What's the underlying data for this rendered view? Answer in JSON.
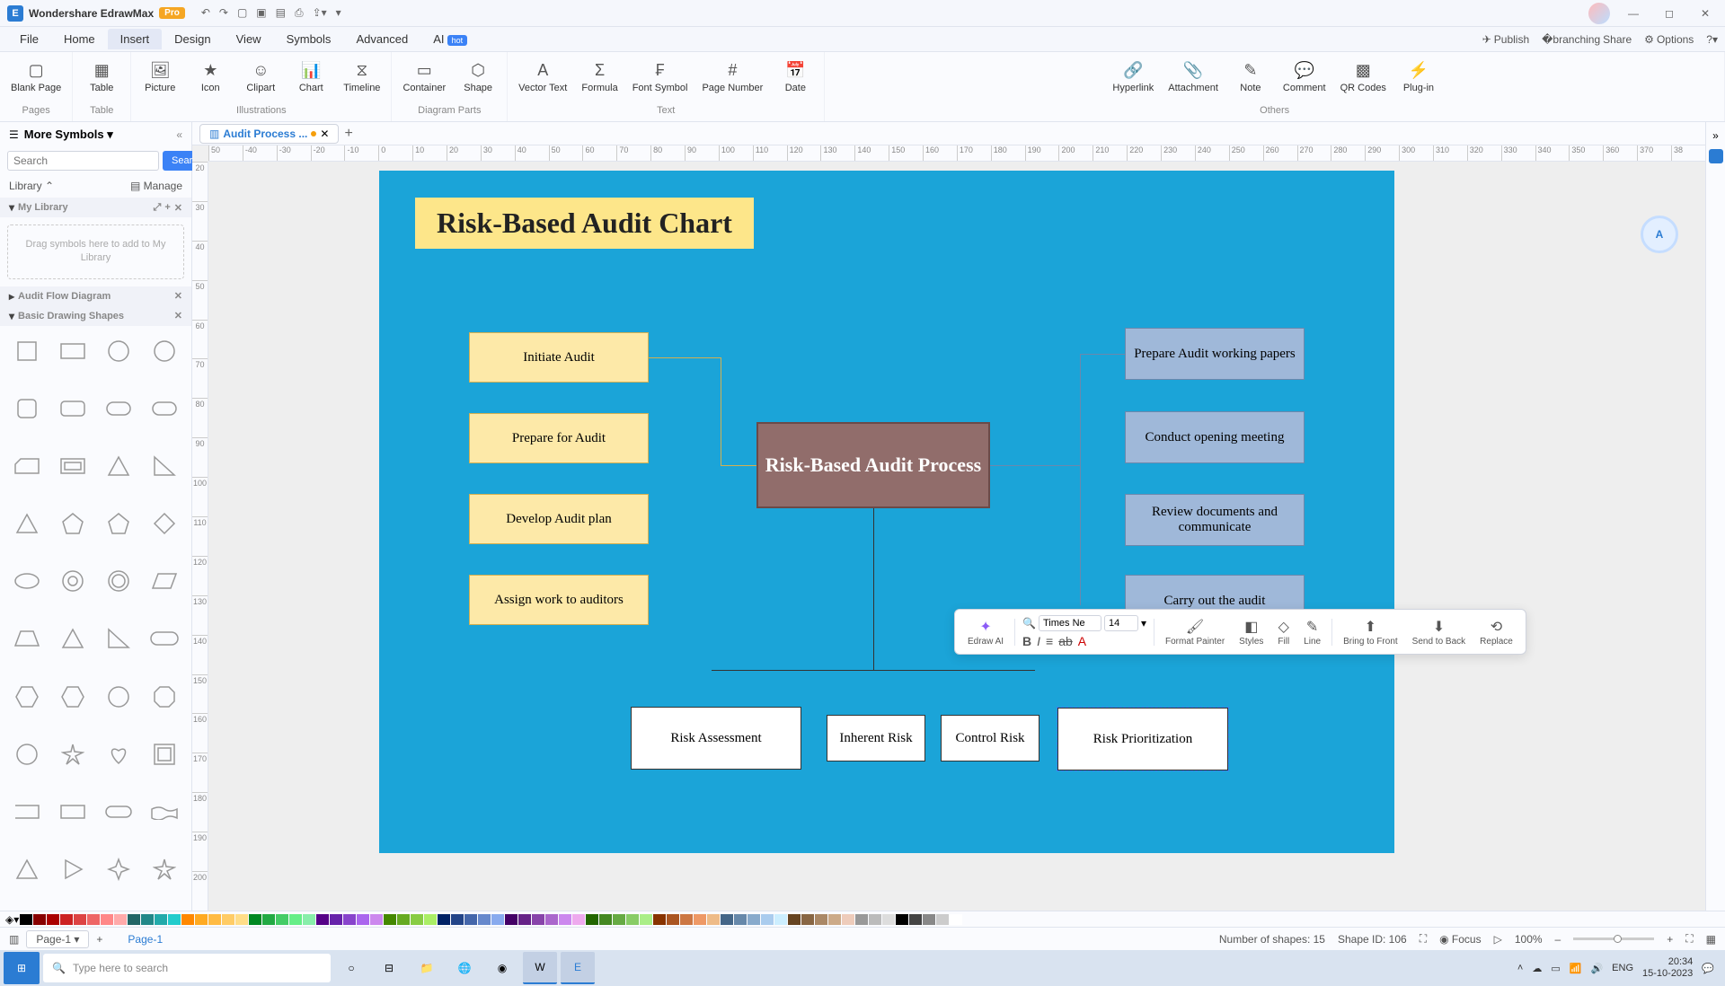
{
  "app": {
    "name": "Wondershare EdrawMax",
    "badge": "Pro"
  },
  "qat": {
    "undo": "↶",
    "redo": "↷"
  },
  "win": {
    "min": "—",
    "max": "◻",
    "close": "✕"
  },
  "menus": {
    "file": "File",
    "home": "Home",
    "insert": "Insert",
    "design": "Design",
    "view": "View",
    "symbols": "Symbols",
    "advanced": "Advanced",
    "ai": "AI",
    "ai_hot": "hot"
  },
  "menuright": {
    "publish": "Publish",
    "share": "Share",
    "options": "Options"
  },
  "ribbon": {
    "blank": "Blank\nPage",
    "table": "Table",
    "picture": "Picture",
    "icon": "Icon",
    "clipart": "Clipart",
    "chart": "Chart",
    "timeline": "Timeline",
    "container": "Container",
    "shape": "Shape",
    "vtext": "Vector\nText",
    "formula": "Formula",
    "fsymbol": "Font\nSymbol",
    "pnum": "Page\nNumber",
    "date": "Date",
    "hyperlink": "Hyperlink",
    "attach": "Attachment",
    "note": "Note",
    "comment": "Comment",
    "qr": "QR\nCodes",
    "plugin": "Plug-in",
    "g_pages": "Pages",
    "g_table": "Table",
    "g_illus": "Illustrations",
    "g_diag": "Diagram Parts",
    "g_text": "Text",
    "g_others": "Others"
  },
  "sidebar": {
    "title": "More Symbols",
    "search_ph": "Search",
    "search_btn": "Search",
    "library": "Library",
    "manage": "Manage",
    "mylib": "My Library",
    "drop": "Drag symbols here to add to My Library",
    "audit": "Audit Flow Diagram",
    "shapes": "Basic Drawing Shapes"
  },
  "doc": {
    "tab": "Audit Process ..."
  },
  "ruler": {
    "h": [
      "50",
      "-40",
      "-30",
      "-20",
      "-10",
      "0",
      "10",
      "20",
      "30",
      "40",
      "50",
      "60",
      "70",
      "80",
      "90",
      "100",
      "110",
      "120",
      "130",
      "140",
      "150",
      "160",
      "170",
      "180",
      "190",
      "200",
      "210",
      "220",
      "230",
      "240",
      "250",
      "260",
      "270",
      "280",
      "290",
      "300",
      "310",
      "320",
      "330",
      "340",
      "350",
      "360",
      "370",
      "38"
    ],
    "v": [
      "20",
      "30",
      "40",
      "50",
      "60",
      "70",
      "80",
      "90",
      "100",
      "110",
      "120",
      "130",
      "140",
      "150",
      "160",
      "170",
      "180",
      "190",
      "200"
    ]
  },
  "chart": {
    "title": "Risk-Based Audit Chart",
    "y1": "Initiate Audit",
    "y2": "Prepare for Audit",
    "y3": "Develop Audit plan",
    "y4": "Assign work to auditors",
    "center": "Risk-Based Audit Process",
    "b1": "Prepare Audit working papers",
    "b2": "Conduct opening meeting",
    "b3": "Review documents and communicate",
    "b4": "Carry out the audit",
    "w1": "Risk Assessment",
    "w2": "Inherent Risk",
    "w3": "Control Risk",
    "w4": "Risk Prioritization"
  },
  "float": {
    "edraw": "Edraw AI",
    "font": "Times Ne",
    "size": "14",
    "format": "Format\nPainter",
    "styles": "Styles",
    "fill": "Fill",
    "line": "Line",
    "front": "Bring to\nFront",
    "back": "Send to\nBack",
    "replace": "Replace"
  },
  "status": {
    "page_tab": "Page-1",
    "page_lbl": "Page-1",
    "shapes": "Number of shapes: 15",
    "shapeid": "Shape ID: 106",
    "focus": "Focus",
    "zoom": "100%"
  },
  "taskbar": {
    "search": "Type here to search",
    "lang": "ENG",
    "time": "20:34",
    "date": "15-10-2023"
  },
  "colors": [
    "#000",
    "#800",
    "#a00",
    "#c22",
    "#d44",
    "#e66",
    "#f88",
    "#faa",
    "#266",
    "#288",
    "#2aa",
    "#2cc",
    "#f80",
    "#fa2",
    "#fb4",
    "#fc6",
    "#fd8",
    "#082",
    "#2a4",
    "#4c6",
    "#6e8",
    "#8ea",
    "#508",
    "#62a",
    "#84c",
    "#a6e",
    "#c8e",
    "#480",
    "#6a2",
    "#8c4",
    "#ae6",
    "#026",
    "#248",
    "#46a",
    "#68c",
    "#8ae",
    "#406",
    "#628",
    "#84a",
    "#a6c",
    "#c8e",
    "#eae",
    "#260",
    "#482",
    "#6a4",
    "#8c6",
    "#ae8",
    "#830",
    "#a52",
    "#c74",
    "#e96",
    "#eb8",
    "#468",
    "#68a",
    "#8ac",
    "#ace",
    "#cef",
    "#642",
    "#864",
    "#a86",
    "#ca8",
    "#ecb",
    "#999",
    "#bbb",
    "#ddd",
    "#000",
    "#444",
    "#888",
    "#ccc",
    "#fff"
  ]
}
